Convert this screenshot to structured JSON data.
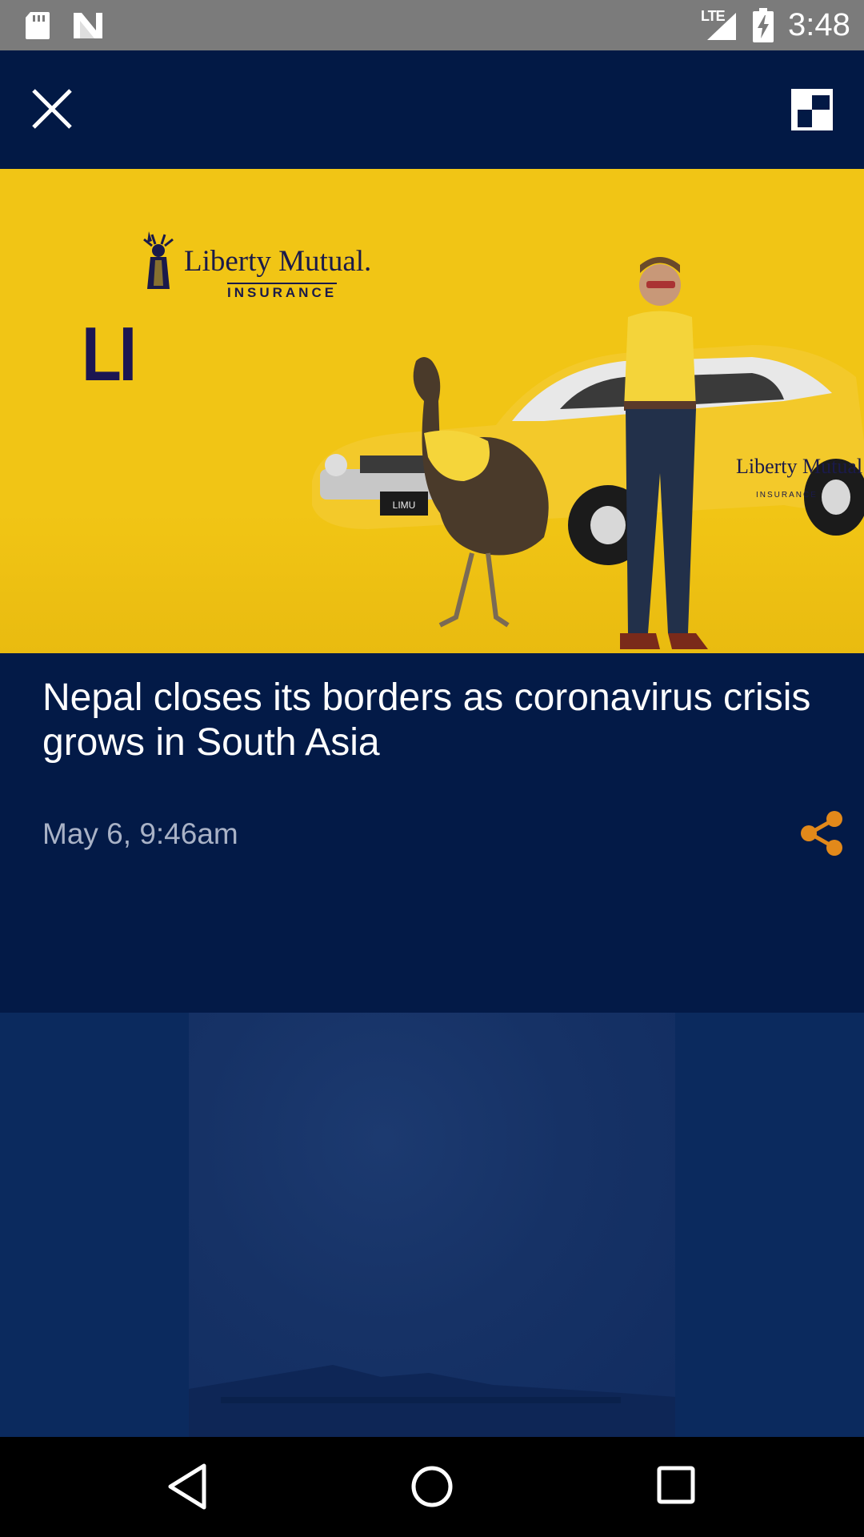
{
  "status_bar": {
    "time": "3:48",
    "network": "LTE",
    "icons": [
      "sd-card-icon",
      "n-notification-icon",
      "signal-icon",
      "battery-charging-icon"
    ]
  },
  "top_bar": {
    "close_icon": "close-icon",
    "pip_icon": "picture-in-picture-icon"
  },
  "ad": {
    "brand_name": "Liberty Mutual.",
    "brand_subline": "INSURANCE",
    "mark": "LI",
    "plate": "LIMU",
    "car_brand": "Liberty Mutual",
    "car_subline": "INSURANCE"
  },
  "article": {
    "headline": "Nepal closes its borders as coronavirus crisis grows in South Asia",
    "timestamp": "May 6, 9:46am",
    "share_icon": "share-icon",
    "accent_color": "#e2891a"
  },
  "nav_bar": {
    "icons": [
      "back-icon",
      "home-icon",
      "recents-icon"
    ]
  }
}
